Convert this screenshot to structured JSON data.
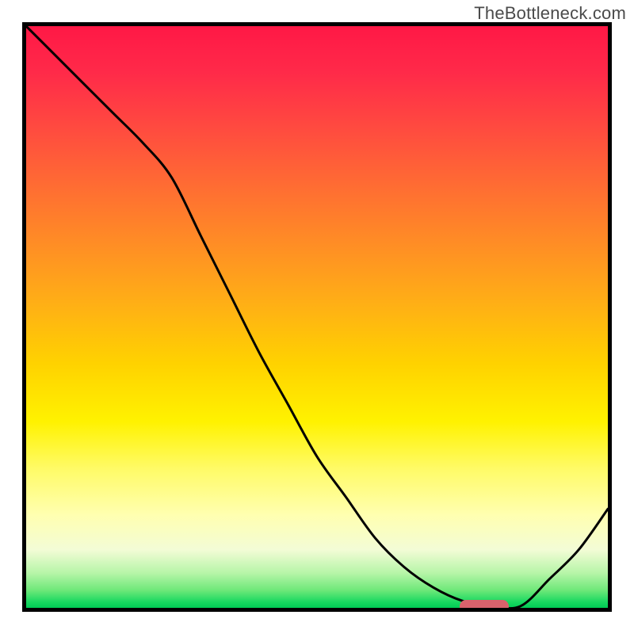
{
  "watermark": "TheBottleneck.com",
  "chart_data": {
    "type": "line",
    "title": "",
    "xlabel": "",
    "ylabel": "",
    "x": [
      0.0,
      0.05,
      0.1,
      0.15,
      0.2,
      0.25,
      0.3,
      0.35,
      0.4,
      0.45,
      0.5,
      0.55,
      0.6,
      0.65,
      0.7,
      0.75,
      0.8,
      0.85,
      0.9,
      0.95,
      1.0
    ],
    "values": [
      1.0,
      0.95,
      0.9,
      0.85,
      0.8,
      0.74,
      0.64,
      0.54,
      0.44,
      0.35,
      0.26,
      0.19,
      0.12,
      0.07,
      0.035,
      0.012,
      0.003,
      0.003,
      0.05,
      0.1,
      0.17
    ],
    "xlim": [
      0,
      1
    ],
    "ylim": [
      0,
      1
    ],
    "marker": {
      "x_start": 0.745,
      "x_end": 0.83,
      "y": 0.003
    },
    "legend": false,
    "grid": false
  },
  "colors": {
    "border": "#000000",
    "curve": "#000000",
    "marker": "#d9626c",
    "watermark": "#4a4a4a"
  }
}
